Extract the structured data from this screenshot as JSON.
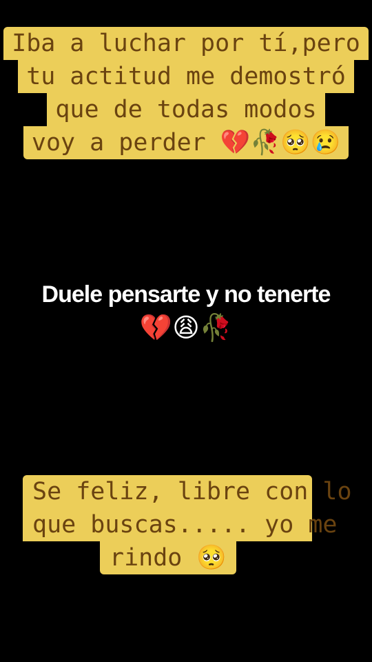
{
  "captions": {
    "top": {
      "lines": [
        "Iba a luchar por tí,pero",
        "tu actitud me demostró",
        "que de todas modos",
        "voy a perder 💔🥀🥺😢"
      ]
    },
    "center": {
      "text": "Duele pensarte y no tenerte",
      "emojis": "💔😩🥀"
    },
    "bottom": {
      "lines": [
        "Se feliz, libre con lo",
        "que buscas..... yo me",
        "rindo 🥺"
      ]
    }
  },
  "colors": {
    "background": "#000000",
    "highlight": "#ecce59",
    "caption_text": "#6a4310",
    "center_text": "#ffffff"
  }
}
